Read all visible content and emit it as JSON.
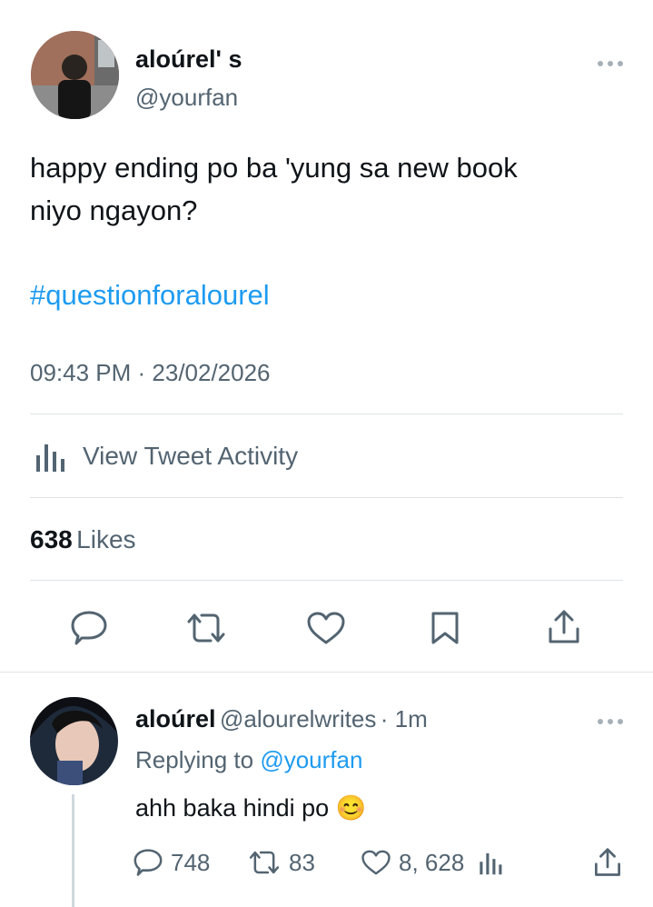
{
  "tweet": {
    "display_name": "aloúrel' s",
    "handle": "@yourfan",
    "text_line1": "happy ending po ba 'yung sa new book",
    "text_line2": "niyo ngayon?",
    "hashtag": "#questionforalourel",
    "timestamp": "09:43 PM · 23/02/2026",
    "activity_label": "View Tweet Activity",
    "likes_count": "638",
    "likes_label": "Likes",
    "avatar_icon": "user-avatar-photo",
    "more_icon": "more-dots-icon"
  },
  "action_bar": {
    "icons": [
      "reply-icon",
      "retweet-icon",
      "like-icon",
      "bookmark-icon",
      "share-icon"
    ]
  },
  "reply": {
    "display_name": "aloúrel",
    "handle": "@alourelwrites",
    "time": "· 1m",
    "replying_prefix": "Replying to",
    "replying_handle": "@yourfan",
    "text": "ahh baka hindi po",
    "emoji": "😊",
    "reply_count": "748",
    "retweet_count": "83",
    "like_count": "8, 628"
  },
  "colors": {
    "accent": "#1d9bf0",
    "text_primary": "#0f1419",
    "text_secondary": "#536471",
    "divider": "#dfe3e6"
  }
}
